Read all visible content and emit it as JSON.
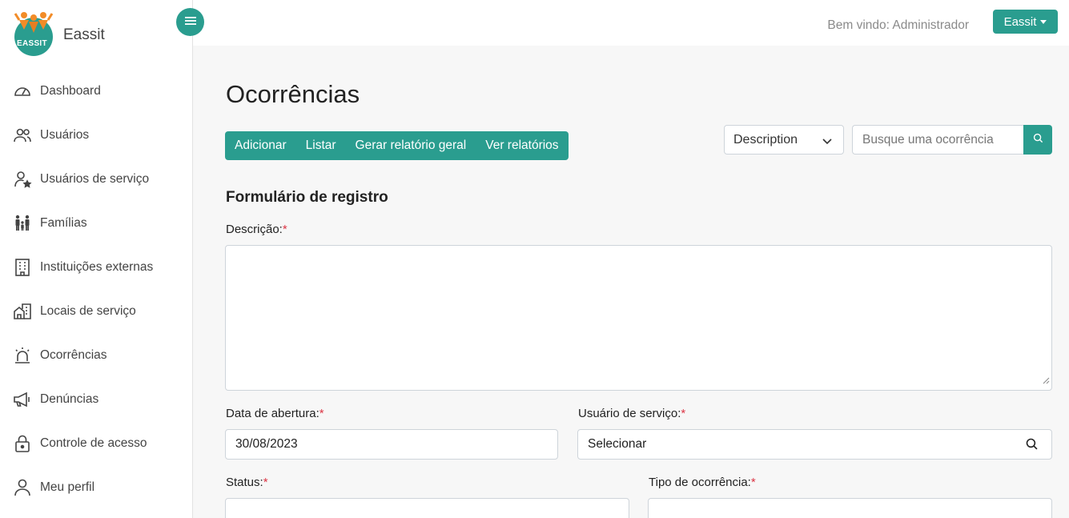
{
  "brand": {
    "name": "Eassit",
    "logo_text": "EASSIT"
  },
  "sidebar": {
    "items": [
      {
        "label": "Dashboard",
        "icon": "speedometer-icon"
      },
      {
        "label": "Usuários",
        "icon": "users-icon"
      },
      {
        "label": "Usuários de serviço",
        "icon": "user-star-icon"
      },
      {
        "label": "Famílias",
        "icon": "family-icon"
      },
      {
        "label": "Instituições externas",
        "icon": "building-icon"
      },
      {
        "label": "Locais de serviço",
        "icon": "house-building-icon"
      },
      {
        "label": "Ocorrências",
        "icon": "alarm-icon"
      },
      {
        "label": "Denúncias",
        "icon": "megaphone-icon"
      },
      {
        "label": "Controle de acesso",
        "icon": "lock-icon"
      },
      {
        "label": "Meu perfil",
        "icon": "person-icon"
      }
    ]
  },
  "header": {
    "welcome": "Bem vindo: Administrador",
    "user_menu": "Eassit"
  },
  "main": {
    "title": "Ocorrências",
    "actions": [
      "Adicionar",
      "Listar",
      "Gerar relatório geral",
      "Ver relatórios"
    ],
    "search": {
      "filter_selected": "Description",
      "placeholder": "Busque uma ocorrência"
    },
    "form": {
      "title": "Formulário de registro",
      "description_label": "Descrição:",
      "opening_date_label": "Data de abertura:",
      "opening_date_value": "30/08/2023",
      "service_user_label": "Usuário de serviço:",
      "service_user_value": "Selecionar",
      "status_label": "Status:",
      "type_label": "Tipo de ocorrência:",
      "required_mark": "*"
    }
  },
  "colors": {
    "accent": "#2a9d8f",
    "required": "#dc3545"
  }
}
